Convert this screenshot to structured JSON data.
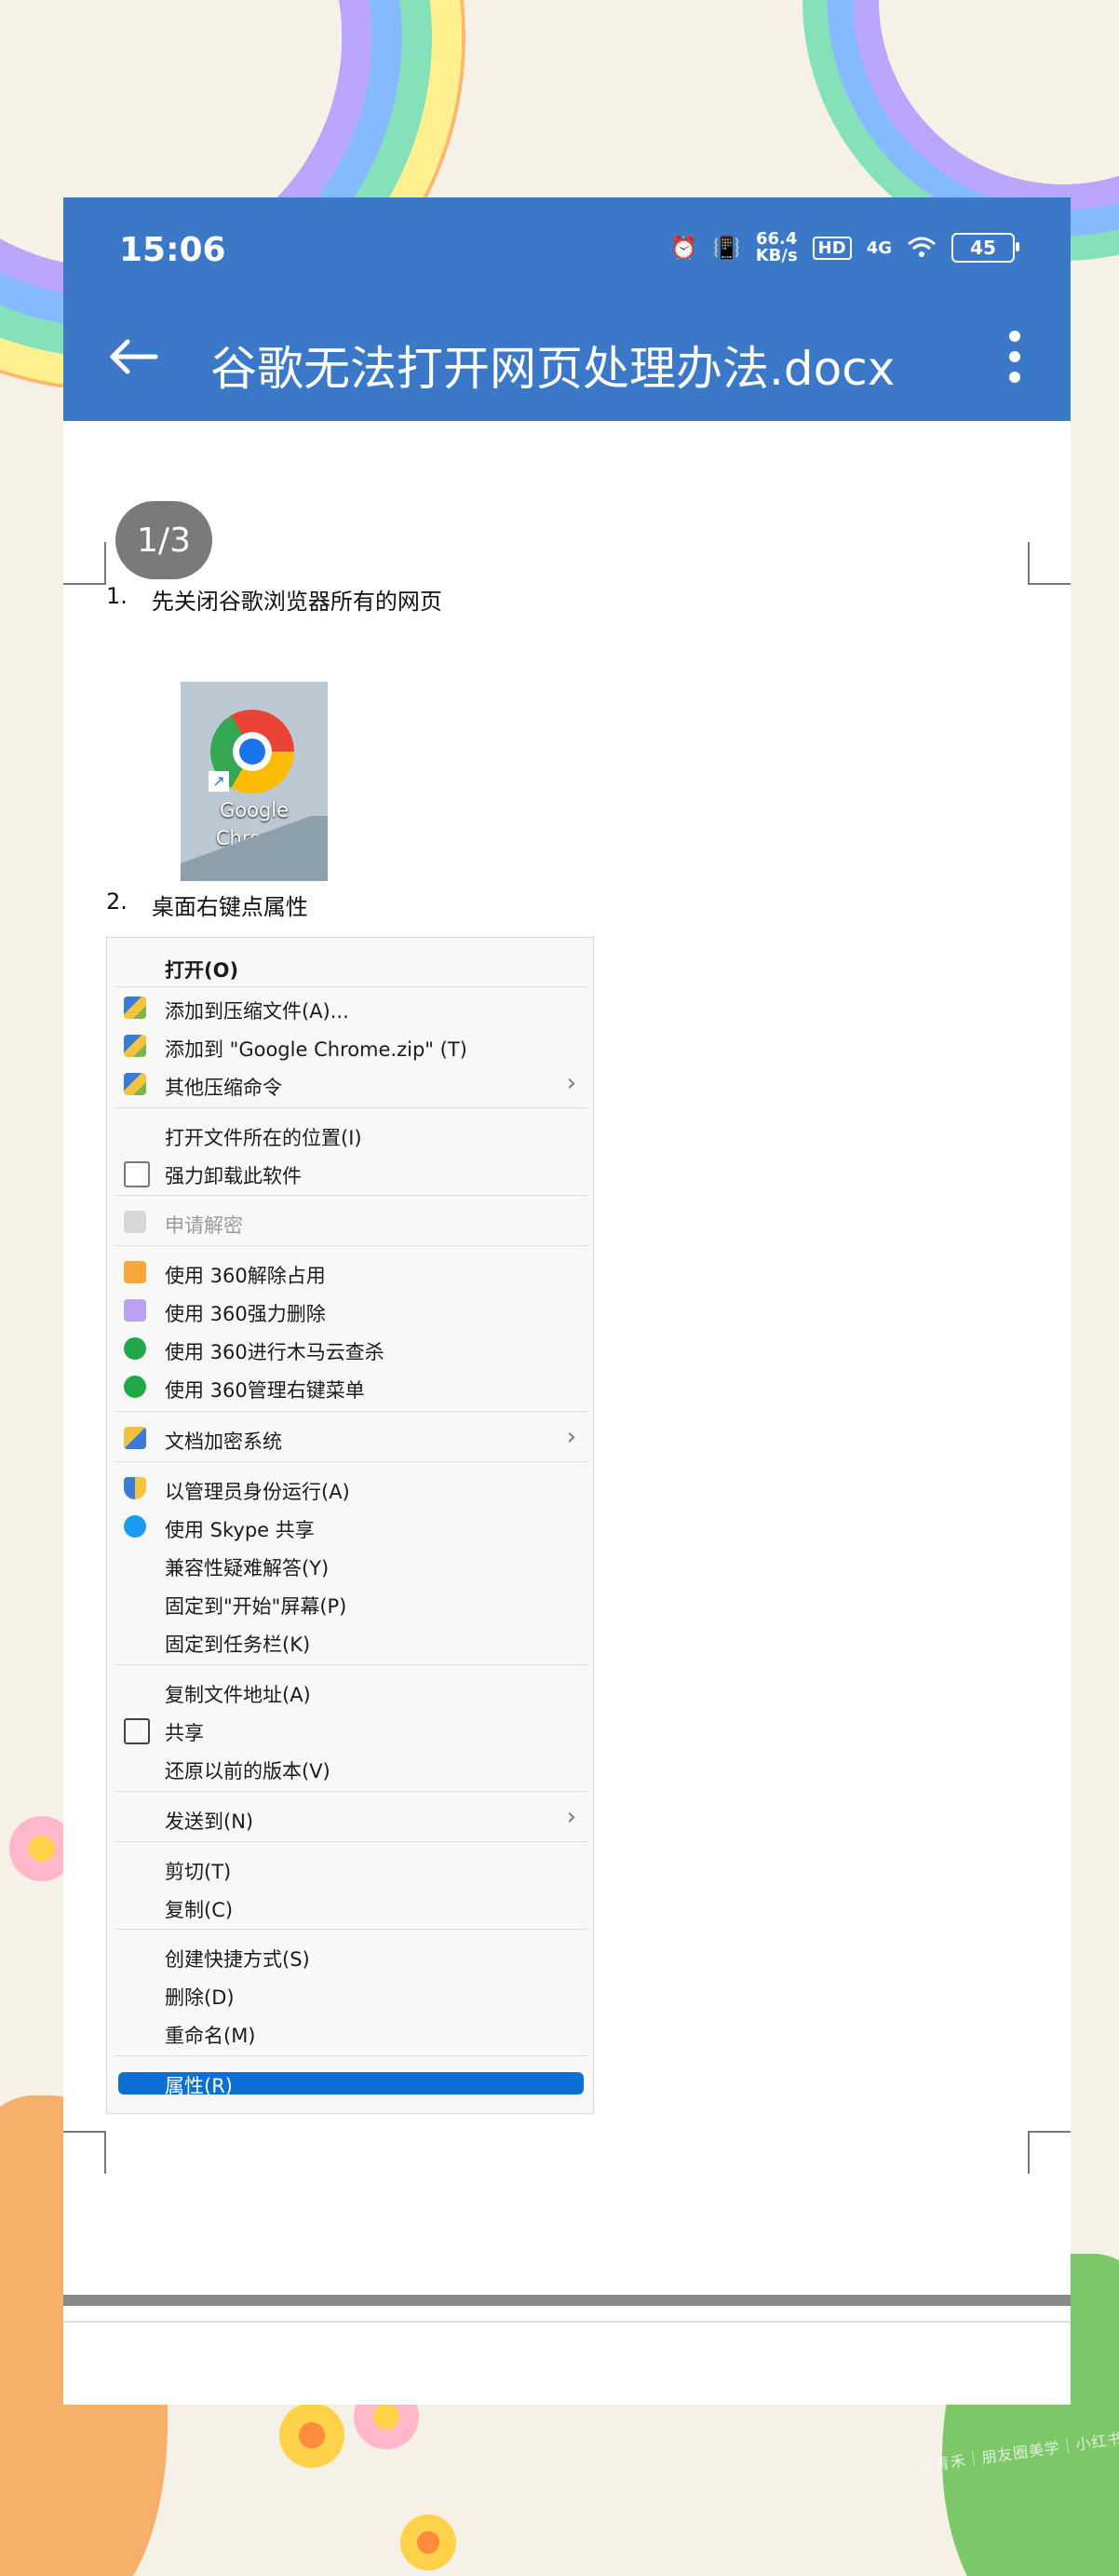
{
  "statusbar": {
    "time": "15:06",
    "net_speed_value": "66.4",
    "net_speed_unit": "KB/s",
    "hd_label": "HD",
    "signal_label": "4G",
    "battery": "45"
  },
  "header": {
    "title": "谷歌无法打开网页处理办法.docx"
  },
  "doc": {
    "page_indicator": "1/3",
    "step1_num": "1.",
    "step1_text": "先关闭谷歌浏览器所有的网页",
    "chrome_label_line1": "Google",
    "chrome_label_line2": "Chrome",
    "step2_num": "2.",
    "step2_text": "桌面右键点属性"
  },
  "context_menu": {
    "items": [
      {
        "label": "打开(O)"
      },
      {
        "label": "添加到压缩文件(A)..."
      },
      {
        "label": "添加到 \"Google Chrome.zip\" (T)"
      },
      {
        "label": "其他压缩命令"
      },
      {
        "label": "打开文件所在的位置(I)"
      },
      {
        "label": "强力卸载此软件"
      },
      {
        "label": "申请解密"
      },
      {
        "label": "使用 360解除占用"
      },
      {
        "label": "使用 360强力删除"
      },
      {
        "label": "使用 360进行木马云查杀"
      },
      {
        "label": "使用 360管理右键菜单"
      },
      {
        "label": "文档加密系统"
      },
      {
        "label": "以管理员身份运行(A)"
      },
      {
        "label": "使用 Skype 共享"
      },
      {
        "label": "兼容性疑难解答(Y)"
      },
      {
        "label": "固定到\"开始\"屏幕(P)"
      },
      {
        "label": "固定到任务栏(K)"
      },
      {
        "label": "复制文件地址(A)"
      },
      {
        "label": "共享"
      },
      {
        "label": "还原以前的版本(V)"
      },
      {
        "label": "发送到(N)"
      },
      {
        "label": "剪切(T)"
      },
      {
        "label": "复制(C)"
      },
      {
        "label": "创建快捷方式(S)"
      },
      {
        "label": "删除(D)"
      },
      {
        "label": "重命名(M)"
      },
      {
        "label": "属性(R)"
      }
    ]
  },
  "watermark": "@青禾｜朋友圈美学｜小红书",
  "colors": {
    "header_blue": "#3b79c8",
    "menu_selected": "#0b6fd6"
  }
}
